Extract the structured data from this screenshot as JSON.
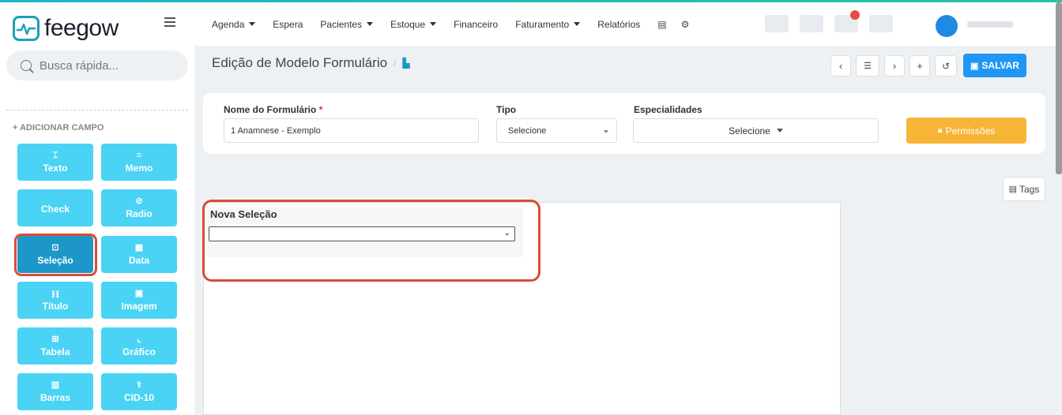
{
  "brand": {
    "name": "feegow"
  },
  "search": {
    "placeholder": "Busca rápida..."
  },
  "sidebar": {
    "add_field_label": "+ ADICIONAR CAMPO",
    "fields": [
      {
        "label": "Texto",
        "icon": "text-icon",
        "glyph": "⌶"
      },
      {
        "label": "Memo",
        "icon": "memo-icon",
        "glyph": "≡"
      },
      {
        "label": "Check",
        "icon": "check-icon",
        "glyph": ""
      },
      {
        "label": "Radio",
        "icon": "radio-icon",
        "glyph": "⊘"
      },
      {
        "label": "Seleção",
        "icon": "select-icon",
        "glyph": "⊡"
      },
      {
        "label": "Data",
        "icon": "calendar-icon",
        "glyph": "▦"
      },
      {
        "label": "Título",
        "icon": "heading-icon",
        "glyph": "H"
      },
      {
        "label": "Imagem",
        "icon": "image-icon",
        "glyph": "▣"
      },
      {
        "label": "Tabela",
        "icon": "table-icon",
        "glyph": "⊞"
      },
      {
        "label": "Gráfico",
        "icon": "chart-icon",
        "glyph": "⌞"
      },
      {
        "label": "Barras",
        "icon": "barcode-icon",
        "glyph": "▥"
      },
      {
        "label": "CID-10",
        "icon": "stethoscope-icon",
        "glyph": "⚕"
      }
    ]
  },
  "nav": {
    "agenda": "Agenda",
    "espera": "Espera",
    "pacientes": "Pacientes",
    "estoque": "Estoque",
    "financeiro": "Financeiro",
    "faturamento": "Faturamento",
    "relatorios": "Relatórios"
  },
  "page": {
    "title": "Edição de Modelo Formulário",
    "separator": "/",
    "save_label": "SALVAR"
  },
  "form": {
    "name_label": "Nome do Formulário",
    "required_mark": "*",
    "name_value": "1 Anamnese - Exemplo",
    "type_label": "Tipo",
    "type_value": "Selecione",
    "spec_label": "Especialidades",
    "spec_value": "Selecione",
    "permissions_label": "Permissões"
  },
  "tags_label": "Tags",
  "canvas": {
    "new_selection_label": "Nova Seleção"
  },
  "colors": {
    "primary": "#2196f3",
    "field_button": "#4ad3f5",
    "field_button_active": "#1d97c7",
    "highlight": "#dc4a38",
    "permissions": "#f7b538"
  }
}
